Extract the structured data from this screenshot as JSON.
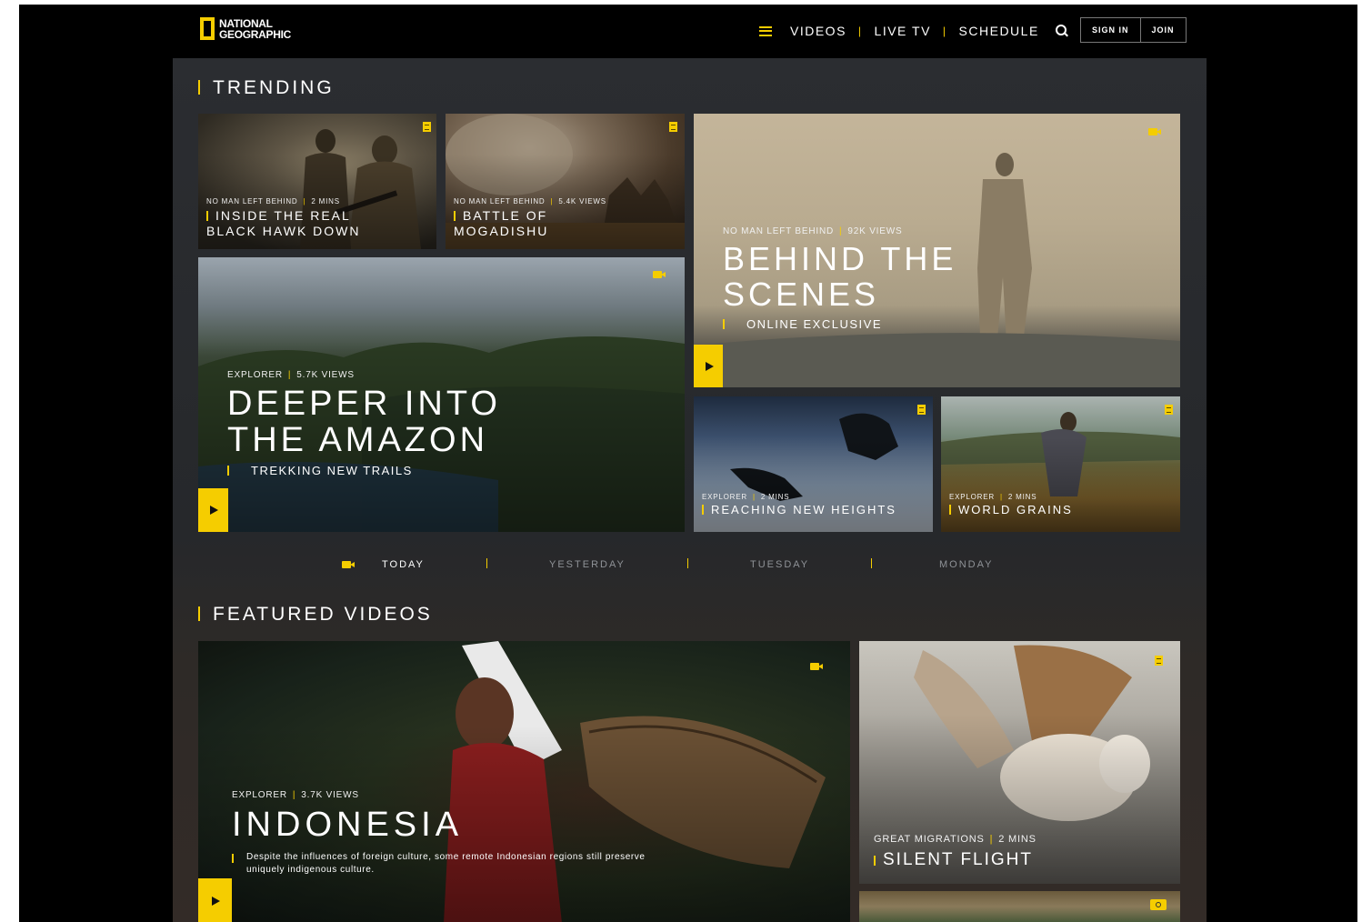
{
  "header": {
    "logo_line1": "NATIONAL",
    "logo_line2": "GEOGRAPHIC",
    "nav": [
      "VIDEOS",
      "LIVE TV",
      "SCHEDULE"
    ],
    "sign_in": "SIGN IN",
    "join": "JOIN"
  },
  "trending": {
    "title": "TRENDING",
    "cards": [
      {
        "meta_left": "NO MAN LEFT BEHIND",
        "meta_right": "2 MINS",
        "title": "INSIDE THE REAL\nBLACK HAWK DOWN",
        "icon": "article-icon"
      },
      {
        "meta_left": "NO MAN LEFT BEHIND",
        "meta_right": "5.4K VIEWS",
        "title": "BATTLE OF\nMOGADISHU",
        "icon": "article-icon"
      },
      {
        "meta_left": "EXPLORER",
        "meta_right": "5.7K VIEWS",
        "title": "DEEPER INTO\nTHE AMAZON",
        "subtitle": "TREKKING NEW TRAILS",
        "icon": "video-icon"
      },
      {
        "meta_left": "NO MAN LEFT BEHIND",
        "meta_right": "92K VIEWS",
        "title": "BEHIND THE\nSCENES",
        "subtitle": "ONLINE EXCLUSIVE",
        "icon": "video-icon"
      },
      {
        "meta_left": "EXPLORER",
        "meta_right": "2 MINS",
        "title": "REACHING NEW HEIGHTS",
        "icon": "article-icon"
      },
      {
        "meta_left": "EXPLORER",
        "meta_right": "2 MINS",
        "title": "WORLD GRAINS",
        "icon": "article-icon"
      }
    ],
    "days": [
      "TODAY",
      "YESTERDAY",
      "TUESDAY",
      "MONDAY"
    ],
    "active_day": "TODAY"
  },
  "featured": {
    "title": "FEATURED VIDEOS",
    "cards": [
      {
        "meta_left": "EXPLORER",
        "meta_right": "3.7K VIEWS",
        "title": "INDONESIA",
        "description": "Despite the influences of foreign culture, some remote Indonesian regions still preserve uniquely indigenous culture.",
        "icon": "video-icon"
      },
      {
        "meta_left": "GREAT MIGRATIONS",
        "meta_right": "2 MINS",
        "title": "SILENT FLIGHT",
        "icon": "article-icon"
      },
      {
        "icon": "camera-icon"
      }
    ]
  },
  "colors": {
    "accent": "#f5cd00",
    "background": "#000000",
    "panel": "#2a2c30"
  }
}
